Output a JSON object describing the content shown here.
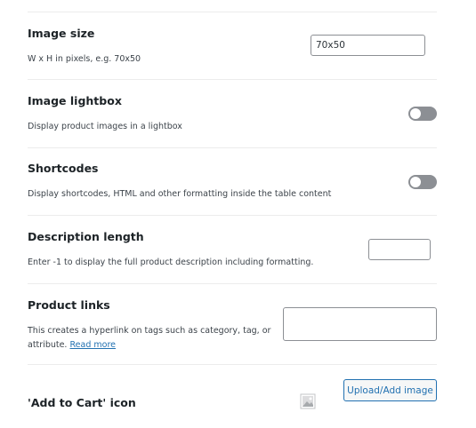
{
  "settings": {
    "image_size": {
      "label": "Image size",
      "description": "W x H in pixels, e.g. 70x50",
      "value": "70x50"
    },
    "image_lightbox": {
      "label": "Image lightbox",
      "description": "Display product images in a lightbox",
      "enabled": false
    },
    "shortcodes": {
      "label": "Shortcodes",
      "description": "Display shortcodes, HTML and other formatting inside the table content",
      "enabled": false
    },
    "description_length": {
      "label": "Description length",
      "description": "Enter -1 to display the full product description including formatting.",
      "value": ""
    },
    "product_links": {
      "label": "Product links",
      "description_line1": "This creates a hyperlink on tags such as category, tag, or",
      "description_line2": "attribute.",
      "read_more": "Read more",
      "value": ""
    },
    "add_to_cart_icon": {
      "label": "'Add to Cart' icon",
      "button_label": "Upload/Add image",
      "placeholder_icon": "image-placeholder-icon"
    }
  },
  "colors": {
    "accent": "#2271b1",
    "toggle_off": "#8c8f94",
    "divider": "#ececec",
    "text": "#1d2327"
  }
}
